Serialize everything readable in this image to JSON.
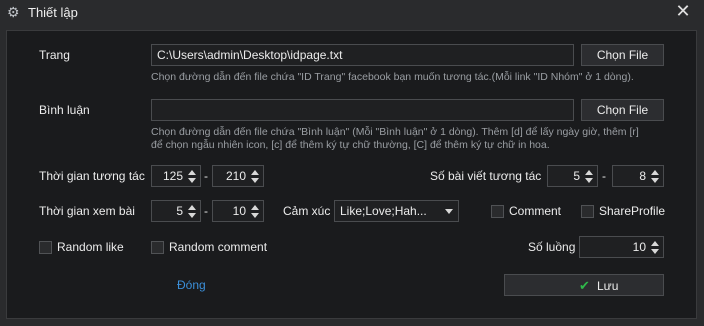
{
  "window": {
    "title": "Thiết lập",
    "icon": "gear-icon",
    "close_icon": "close-icon"
  },
  "page_field": {
    "label": "Trang",
    "value": "C:\\Users\\admin\\Desktop\\idpage.txt",
    "button": "Chọn File",
    "hint": "Chọn đường dẫn đến file chứa \"ID Trang\" facebook bạn muốn tương tác.(Mỗi link \"ID Nhóm\" ở 1 dòng)."
  },
  "comment_field": {
    "label": "Bình luận",
    "value": "",
    "button": "Chọn File",
    "hint_line1": "Chọn đường dẫn đến file chứa \"Bình luận\" (Mỗi \"Bình luận\" ở 1 dòng). Thêm [d] để lấy ngày giờ, thêm [r]",
    "hint_line2": "để chọn ngẫu nhiên icon, [c] để thêm ký tự chữ thường, [C] để thêm ký tự chữ in hoa."
  },
  "interaction_time": {
    "label": "Thời gian tương tác",
    "from": "125",
    "to": "210",
    "separator": "-"
  },
  "posts_interact": {
    "label": "Số bài viết tương tác",
    "from": "5",
    "to": "8",
    "separator": "-"
  },
  "view_time": {
    "label": "Thời gian xem bài",
    "from": "5",
    "to": "10",
    "separator": "-"
  },
  "emotion": {
    "label": "Cảm xúc",
    "selected": "Like;Love;Hah..."
  },
  "checkboxes": {
    "comment": "Comment",
    "share_profile": "ShareProfile",
    "random_like": "Random like",
    "random_comment": "Random comment"
  },
  "threads": {
    "label": "Số luồng",
    "value": "10"
  },
  "footer": {
    "close_link": "Đóng",
    "save_button": "Lưu"
  },
  "colors": {
    "background": "#2a2b2d",
    "panel": "#1a1b1d",
    "link": "#3b8fd9",
    "check": "#2fb84a"
  }
}
